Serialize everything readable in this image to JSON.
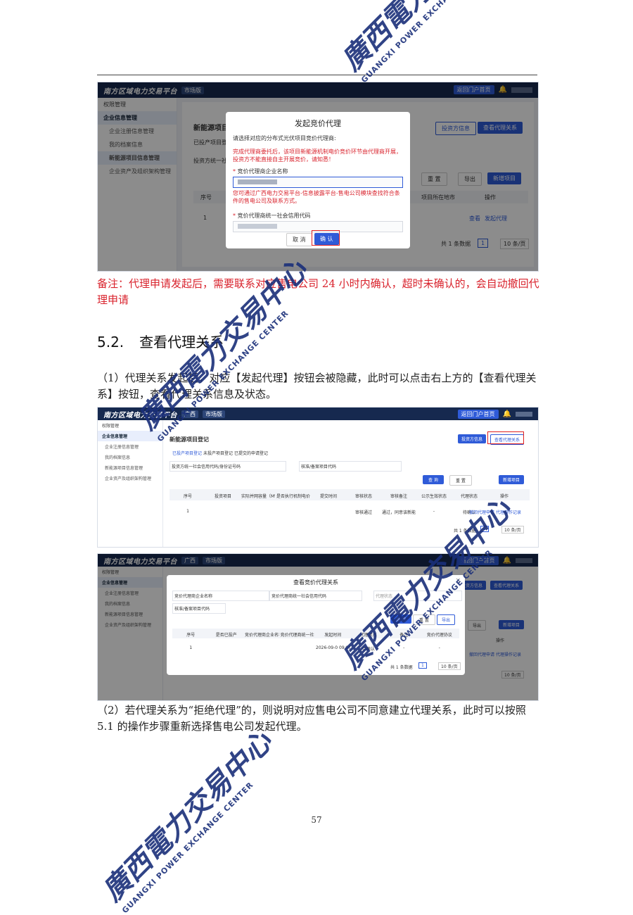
{
  "screenshot1": {
    "brand": "南方区域电力交易平台",
    "env_tag": "市场版",
    "portal_btn": "返回门户首页",
    "sidebar": [
      "权限管理",
      "企业信息管理",
      "企业注册信息管理",
      "我的档案信息",
      "新能源项目信息管理",
      "企业资产及组织架构管理"
    ],
    "page_title": "新能源项目登记",
    "tab1": "已投产项目登",
    "filter1": "投资方统一社会",
    "btn_invest": "投资方信息",
    "btn_view": "查看代理关系",
    "btn_reset": "重 置",
    "btn_export": "导出",
    "btn_new": "新增项目",
    "col_seq": "序号",
    "col_location": "项目所在地市",
    "col_op": "操作",
    "row_seq": "1",
    "op_view": "查看",
    "op_proxy": "发起代理",
    "total": "共 1 条数据",
    "page": "1",
    "per_page": "10 条/页",
    "modal": {
      "title": "发起竞价代理",
      "intro": "请选择对应的分布式光伏项目竞价代理商:",
      "warn": "完成代理商委托后，该项目新能源机制电价竞价环节由代理商开展，投资方不能直接自主开展竞价，请知悉！",
      "label1": "竞价代理商企业名称",
      "hint": "您可通过广西电力交易平台-信息披露平台-售电公司模块查找符合条件的售电公司及联系方式。",
      "label2": "竞价代理商统一社会信用代码",
      "cancel": "取 消",
      "confirm": "确 认"
    }
  },
  "note": "备注：代理申请发起后，需要联系对应售电公司 24 小时内确认，超时未确认的，会自动撤回代理申请",
  "section_num": "5.2.",
  "section_title": "查看代理关系",
  "para1": "（1）代理关系发起后，对应【发起代理】按钮会被隐藏，此时可以点击右上方的【查看代理关系】按钮，查看代理关系信息及状态。",
  "screenshot2": {
    "brand": "南方区域电力交易平台",
    "region": "广西",
    "env_tag": "市场版",
    "portal_btn": "返回门户首页",
    "sidebar": [
      "权限管理",
      "企业信息管理",
      "企业注册信息管理",
      "我的档案信息",
      "新能源项目信息管理",
      "企业资产及组织架构管理"
    ],
    "page_title": "新能源项目登记",
    "tabs": [
      "已投产项目登记",
      "未投产项目登记",
      "已提交的申请登记"
    ],
    "filter1": "投资方统一社会信用代码/身份证号码",
    "filter2": "核准/备案项目代码",
    "btn_invest": "投资方信息",
    "btn_view": "查看代理关系",
    "btn_query": "查 询",
    "btn_reset": "重 置",
    "btn_new": "新增项目",
    "cols": [
      "序号",
      "投资项目",
      "实际并网容量（MW）",
      "是否执行机制电价",
      "提交时间",
      "审核状态",
      "审核备注",
      "公示生效状态",
      "代理状态",
      "操作"
    ],
    "row": [
      "1",
      "",
      "",
      "",
      "",
      "审核通过",
      "通过，同意该新能源项目参与竞价",
      "-",
      "待确认",
      ""
    ],
    "ops": [
      "撤回代理申请",
      "代理操作记录"
    ],
    "total": "共 1 条数据",
    "page": "1",
    "per_page": "10 条/页"
  },
  "screenshot3": {
    "brand": "南方区域电力交易平台",
    "region": "广西",
    "env_tag": "市场版",
    "portal_btn": "返回门户首页",
    "sidebar": [
      "权限管理",
      "企业信息管理",
      "企业注册信息管理",
      "我的档案信息",
      "新能源项目信息管理",
      "企业资产及组织架构管理"
    ],
    "btn_invest": "投资方信息",
    "btn_view": "查看代理关系",
    "btn_export_bg": "导出",
    "btn_new": "新增项目",
    "bg_op": "操作",
    "bg_ops": [
      "撤回代理申请",
      "代理操作记录"
    ],
    "bg_per_page": "10 条/页",
    "modal": {
      "title": "查看竞价代理关系",
      "f1": "竞价代理商企业名称",
      "f2": "竞价代理商统一社会信用代码",
      "f3": "代理状态",
      "f4": "核准/备案项目代码",
      "query": "查 询",
      "reset": "重 置",
      "export": "导出",
      "cols": [
        "序号",
        "是否已投产",
        "竞价代理商企业名称",
        "竞价代理商统一社会信用代码",
        "发起时间",
        "代理状态",
        "备注",
        "竞价代理协议"
      ],
      "row": [
        "1",
        "",
        "",
        "",
        "2026-09-0 09:06",
        "待确认",
        "-",
        "-"
      ],
      "total": "共 1 条数据",
      "page": "1",
      "per_page": "10 条/页",
      "close": "×"
    }
  },
  "para2": "（2）若代理关系为“拒绝代理”的，则说明对应售电公司不同意建立代理关系，此时可以按照 5.1 的操作步骤重新选择售电公司发起代理。",
  "page_number": "57",
  "watermark": {
    "cn": "廣西電力交易中心",
    "en": "GUANGXI POWER EXCHANGE CENTER",
    "color": "#1a2f7a"
  }
}
